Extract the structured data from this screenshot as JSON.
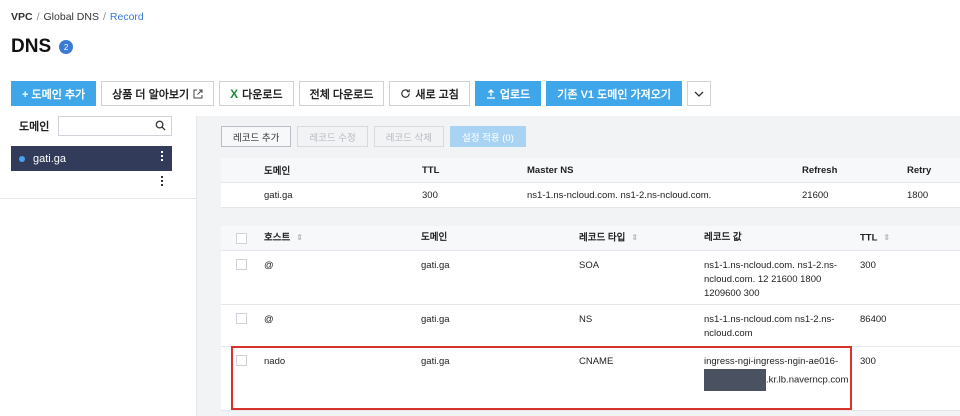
{
  "breadcrumb": [
    "VPC",
    "Global DNS",
    "Record"
  ],
  "page": {
    "title": "DNS",
    "badge": "2"
  },
  "toolbar": {
    "add_domain": "+ 도메인 추가",
    "learn_more": "상품 더 알아보기",
    "download": "다운로드",
    "download_all": "전체 다운로드",
    "refresh": "새로 고침",
    "upload": "업로드",
    "import_v1": "기존 V1 도메인 가져오기"
  },
  "sidebar": {
    "label": "도메인",
    "search_placeholder": "",
    "domains": [
      "gati.ga"
    ]
  },
  "record_actions": {
    "add": "레코드 추가",
    "edit": "레코드 수정",
    "delete": "레코드 삭제",
    "apply": "설정 적용 (0)"
  },
  "domain_info": {
    "headers": [
      "도메인",
      "TTL",
      "Master NS",
      "Refresh",
      "Retry"
    ],
    "row": [
      "gati.ga",
      "300",
      "ns1-1.ns-ncloud.com. ns1-2.ns-ncloud.com.",
      "21600",
      "1800"
    ]
  },
  "records": {
    "headers": [
      "호스트",
      "도메인",
      "레코드 타입",
      "레코드 값",
      "TTL"
    ],
    "rows": [
      {
        "host": "@",
        "domain": "gati.ga",
        "type": "SOA",
        "value": "ns1-1.ns-ncloud.com. ns1-2.ns-ncloud.com. 12 21600 1800 1209600 300",
        "ttl": "300"
      },
      {
        "host": "@",
        "domain": "gati.ga",
        "type": "NS",
        "value": "ns1-1.ns-ncloud.com ns1-2.ns-ncloud.com",
        "ttl": "86400"
      },
      {
        "host": "nado",
        "domain": "gati.ga",
        "type": "CNAME",
        "value_prefix": "ingress-ngi-ingress-ngin-ae016-",
        "value_suffix": ".kr.lb.naverncp.com",
        "ttl": "300"
      }
    ]
  },
  "colors": {
    "primary": "#3fa6ea",
    "sidebar_active": "#323c5a",
    "highlight": "#d9322b"
  }
}
